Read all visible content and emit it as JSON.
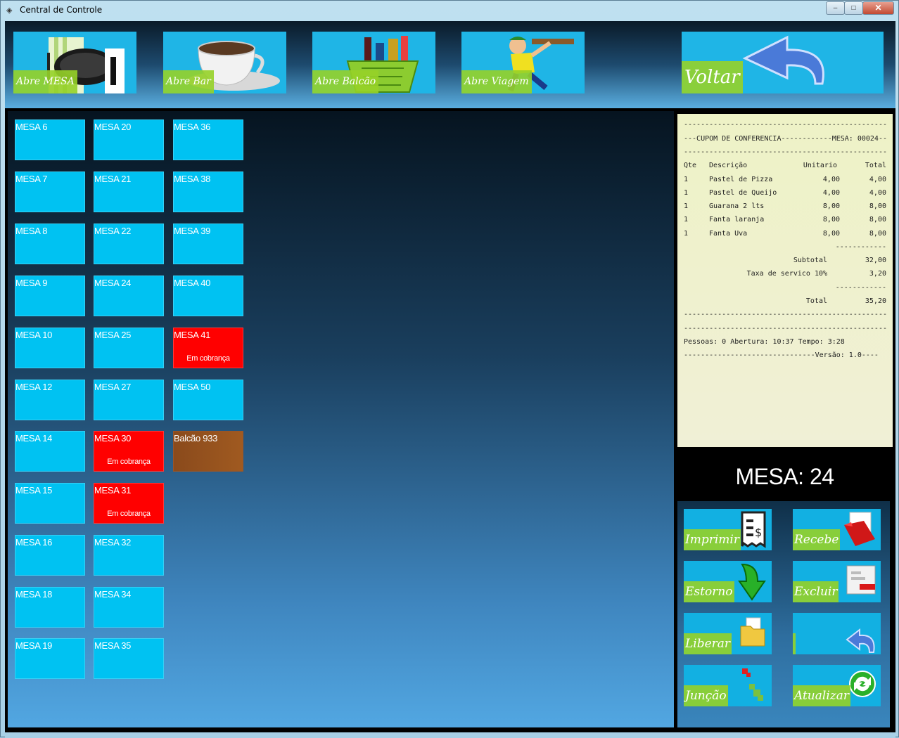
{
  "window": {
    "title": "Central de Controle",
    "minimize": "‒",
    "maximize": "□",
    "close": "✕"
  },
  "toolbar": {
    "abre_mesa": "Abre MESA",
    "abre_bar": "Abre Bar",
    "abre_balcao": "Abre Balcão",
    "abre_viagem": "Abre Viagem",
    "voltar": "Voltar"
  },
  "tables": {
    "col1": [
      {
        "name": "MESA 6"
      },
      {
        "name": "MESA 7"
      },
      {
        "name": "MESA 8"
      },
      {
        "name": "MESA 9"
      },
      {
        "name": "MESA 10"
      },
      {
        "name": "MESA 12"
      },
      {
        "name": "MESA 14"
      },
      {
        "name": "MESA 15"
      },
      {
        "name": "MESA 16"
      },
      {
        "name": "MESA 18"
      },
      {
        "name": "MESA 19"
      }
    ],
    "col2": [
      {
        "name": "MESA 20"
      },
      {
        "name": "MESA 21"
      },
      {
        "name": "MESA 22"
      },
      {
        "name": "MESA 24"
      },
      {
        "name": "MESA 25"
      },
      {
        "name": "MESA 27"
      },
      {
        "name": "MESA 30",
        "status": "Em cobrança"
      },
      {
        "name": "MESA 31",
        "status": "Em cobrança"
      },
      {
        "name": "MESA 32"
      },
      {
        "name": "MESA 34"
      },
      {
        "name": "MESA 35"
      }
    ],
    "col3": [
      {
        "name": "MESA 36"
      },
      {
        "name": "MESA 38"
      },
      {
        "name": "MESA 39"
      },
      {
        "name": "MESA 40"
      },
      {
        "name": "MESA 41",
        "status": "Em cobrança"
      },
      {
        "name": "MESA 50"
      },
      {
        "name": "Balcão 933"
      }
    ]
  },
  "receipt": {
    "dash_line": "------------------------------------------------",
    "header": "---CUPOM DE CONFERENCIA------------MESA: 00024--",
    "columns": {
      "qte": "Qte",
      "descricao": "Descrição",
      "unitario": "Unitario",
      "total": "Total"
    },
    "items": [
      {
        "qte": "1",
        "descricao": "Pastel de Pizza",
        "unitario": "4,00",
        "total": "4,00"
      },
      {
        "qte": "1",
        "descricao": "Pastel de Queijo",
        "unitario": "4,00",
        "total": "4,00"
      },
      {
        "qte": "1",
        "descricao": "Guarana 2 lts",
        "unitario": "8,00",
        "total": "8,00"
      },
      {
        "qte": "1",
        "descricao": "Fanta laranja",
        "unitario": "8,00",
        "total": "8,00"
      },
      {
        "qte": "1",
        "descricao": "Fanta Uva",
        "unitario": "8,00",
        "total": "8,00"
      }
    ],
    "short_dash": "------------",
    "subtotal_label": "Subtotal",
    "subtotal_value": "32,00",
    "taxa_label": "Taxa de servico 10%",
    "taxa_value": "3,20",
    "total_label": "Total",
    "total_value": "35,20",
    "info": "Pessoas: 0 Abertura: 10:37 Tempo: 3:28",
    "versao": "-------------------------------Versão: 1.0----"
  },
  "mesa_label": "MESA: 24",
  "actions": {
    "imprimir": "Imprimir",
    "recebe": "Recebe",
    "estorno": "Estorno",
    "excluir": "Excluir",
    "liberar": "Liberar",
    "voltar_small": "",
    "juncao": "Junção",
    "atualizar": "Atualizar"
  },
  "icons": {
    "title": "app-icon",
    "receipt": "receipt-icon",
    "folder_red": "red-folder-icon",
    "arrow_down": "green-down-arrow-icon",
    "delete": "delete-form-icon",
    "folder": "folder-icon",
    "undo": "blue-undo-arrow-icon",
    "merge": "merge-icon",
    "refresh": "refresh-icon"
  },
  "colors": {
    "tile_free": "#00c2f2",
    "tile_billing": "#ff0000",
    "tile_counter": "#9a5528",
    "label_green": "#96d228",
    "receipt_bg": "#eef2c6"
  }
}
